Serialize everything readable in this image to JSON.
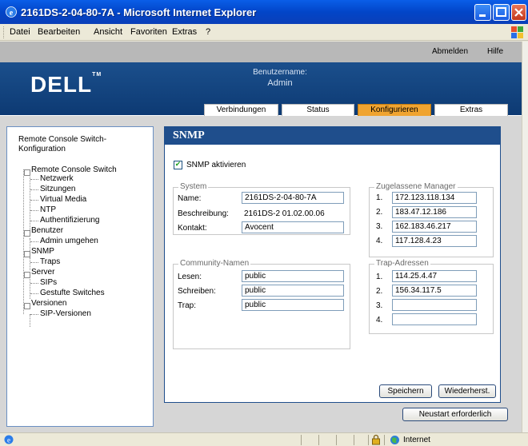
{
  "window": {
    "title": "2161DS-2-04-80-7A - Microsoft Internet Explorer"
  },
  "menubar": {
    "items": [
      "Datei",
      "Bearbeiten",
      "Ansicht",
      "Favoriten",
      "Extras",
      "?"
    ]
  },
  "header": {
    "links": {
      "logout": "Abmelden",
      "help": "Hilfe"
    },
    "logo": "DELL",
    "logo_tm": "TM",
    "username_label": "Benutzername:",
    "username": "Admin",
    "tabs": [
      "Verbindungen",
      "Status",
      "Konfigurieren",
      "Extras"
    ],
    "active_tab": "Konfigurieren"
  },
  "sidebar": {
    "heading": "Remote Console Switch-Konfiguration",
    "tree": [
      {
        "label": "Remote Console Switch",
        "level": 0
      },
      {
        "label": "Netzwerk",
        "level": 1
      },
      {
        "label": "Sitzungen",
        "level": 1
      },
      {
        "label": "Virtual Media",
        "level": 1
      },
      {
        "label": "NTP",
        "level": 1
      },
      {
        "label": "Authentifizierung",
        "level": 1
      },
      {
        "label": "Benutzer",
        "level": 0
      },
      {
        "label": "Admin umgehen",
        "level": 1
      },
      {
        "label": "SNMP",
        "level": 0
      },
      {
        "label": "Traps",
        "level": 1
      },
      {
        "label": "Server",
        "level": 0
      },
      {
        "label": "SIPs",
        "level": 1
      },
      {
        "label": "Gestufte Switches",
        "level": 1
      },
      {
        "label": "Versionen",
        "level": 0
      },
      {
        "label": "SIP-Versionen",
        "level": 1
      }
    ]
  },
  "main": {
    "title": "SNMP",
    "snmp_enable_label": "SNMP aktivieren",
    "snmp_enabled": true,
    "system": {
      "group_label": "System",
      "name_label": "Name:",
      "name_value": "2161DS-2-04-80-7A",
      "description_label": "Beschreibung:",
      "description_value": "2161DS-2 01.02.00.06",
      "contact_label": "Kontakt:",
      "contact_value": "Avocent"
    },
    "managers": {
      "group_label": "Zugelassene Manager",
      "entries": [
        {
          "num": "1.",
          "value": "172.123.118.134"
        },
        {
          "num": "2.",
          "value": "183.47.12.186"
        },
        {
          "num": "3.",
          "value": "162.183.46.217"
        },
        {
          "num": "4.",
          "value": "117.128.4.23"
        }
      ]
    },
    "community": {
      "group_label": "Community-Namen",
      "read_label": "Lesen:",
      "read_value": "public",
      "write_label": "Schreiben:",
      "write_value": "public",
      "trap_label": "Trap:",
      "trap_value": "public"
    },
    "traps": {
      "group_label": "Trap-Adressen",
      "entries": [
        {
          "num": "1.",
          "value": "114.25.4.47"
        },
        {
          "num": "2.",
          "value": "156.34.117.5"
        },
        {
          "num": "3.",
          "value": ""
        },
        {
          "num": "4.",
          "value": ""
        }
      ]
    },
    "save_button": "Speichern",
    "restore_button": "Wiederherst.",
    "restart_button": "Neustart erforderlich"
  },
  "statusbar": {
    "zone": "Internet"
  }
}
